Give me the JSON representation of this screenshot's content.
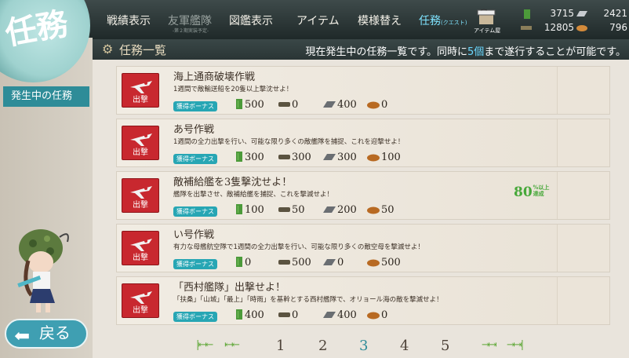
{
  "topbar": {
    "emblem_text": "任務",
    "nav": [
      {
        "label": "戦績表示",
        "sub": ""
      },
      {
        "label": "友軍艦隊",
        "sub": "-第２期実装予定-"
      },
      {
        "label": "図鑑表示",
        "sub": ""
      },
      {
        "label": "アイテム",
        "sub": ""
      },
      {
        "label": "模様替え",
        "sub": ""
      },
      {
        "label": "任務",
        "sub": "(クエスト)"
      }
    ],
    "item_shop_label": "アイテム屋",
    "resources": {
      "fuel": "3715",
      "ammo": "12805",
      "steel": "2421",
      "bauxite": "796"
    }
  },
  "header": {
    "title": "任務一覧",
    "desc_pre": "現在発生中の任務一覧です。同時に",
    "desc_num": "5個",
    "desc_post": "まで遂行することが可能です。"
  },
  "sidebar": {
    "active_tab": "発生中の任務",
    "back_label": "戻る"
  },
  "quests": [
    {
      "category": "出撃",
      "name": "海上通商破壊作戦",
      "desc": "1週間で敵輸送船を20隻以上撃沈せよ！",
      "bonus": "獲得ボーナス",
      "fuel": "500",
      "ammo": "0",
      "steel": "400",
      "bauxite": "0",
      "progress_label": ""
    },
    {
      "category": "出撃",
      "name": "あ号作戦",
      "desc": "1週間の全力出撃を行い、可能な限り多くの敵艦隊を捕捉、これを迎撃せよ！",
      "bonus": "獲得ボーナス",
      "fuel": "300",
      "ammo": "300",
      "steel": "300",
      "bauxite": "100",
      "progress_label": ""
    },
    {
      "category": "出撃",
      "name": "敵補給艦を3隻撃沈せよ！",
      "desc": "艦隊を出撃させ、敵補給艦を捕捉、これを撃滅せよ！",
      "bonus": "獲得ボーナス",
      "fuel": "100",
      "ammo": "50",
      "steel": "200",
      "bauxite": "50",
      "progress_label": "80",
      "progress_suffix": "%以上達成"
    },
    {
      "category": "出撃",
      "name": "い号作戦",
      "desc": "有力な母艦航空隊で1週間の全力出撃を行い、可能な限り多くの敵空母を撃滅せよ！",
      "bonus": "獲得ボーナス",
      "fuel": "0",
      "ammo": "500",
      "steel": "0",
      "bauxite": "500",
      "progress_label": ""
    },
    {
      "category": "出撃",
      "name": "「西村艦隊」出撃せよ！",
      "desc": "「扶桑」「山城」「最上」「時雨」を基幹とする西村艦隊で、オリョール海の敵を撃滅せよ！",
      "bonus": "獲得ボーナス",
      "fuel": "400",
      "ammo": "0",
      "steel": "400",
      "bauxite": "0",
      "progress_label": ""
    }
  ],
  "pager": {
    "pages": [
      "1",
      "2",
      "3",
      "4",
      "5"
    ],
    "current": "3"
  },
  "colors": {
    "accent": "#2e8c98",
    "category_red": "#c8282f",
    "progress_green": "#47a83a"
  }
}
